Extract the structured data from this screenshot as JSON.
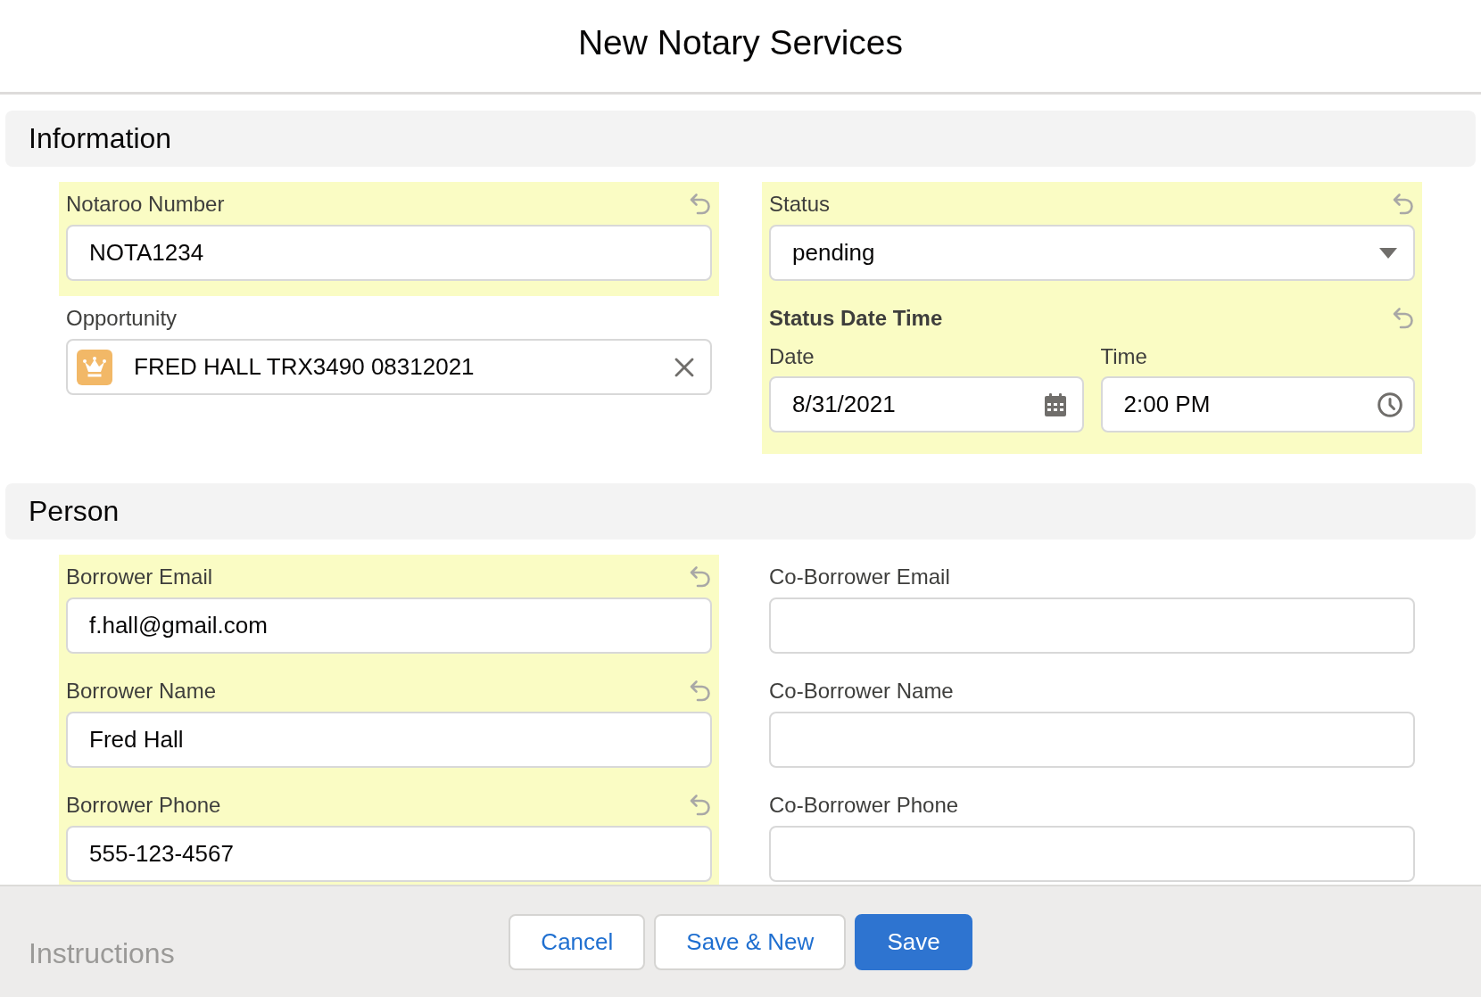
{
  "dialog": {
    "title": "New Notary Services"
  },
  "sections": [
    {
      "title": "Information",
      "columns": [
        [
          {
            "kind": "text",
            "label": "Notaroo Number",
            "value": "NOTA1234",
            "changed": true
          },
          {
            "kind": "lookup",
            "label": "Opportunity",
            "value": "FRED HALL TRX3490 08312021",
            "changed": false
          }
        ],
        [
          {
            "kind": "picklist",
            "label": "Status",
            "value": "pending",
            "changed": true
          },
          {
            "kind": "datetime",
            "label": "Status Date Time",
            "changed": true,
            "date": {
              "label": "Date",
              "value": "8/31/2021"
            },
            "time": {
              "label": "Time",
              "value": "2:00 PM"
            }
          }
        ]
      ]
    },
    {
      "title": "Person",
      "columns": [
        [
          {
            "kind": "text",
            "label": "Borrower Email",
            "value": "f.hall@gmail.com",
            "changed": true
          },
          {
            "kind": "text",
            "label": "Borrower Name",
            "value": "Fred Hall",
            "changed": true
          },
          {
            "kind": "text",
            "label": "Borrower Phone",
            "value": "555-123-4567",
            "changed": true
          }
        ],
        [
          {
            "kind": "text",
            "label": "Co-Borrower Email",
            "changed": false
          },
          {
            "kind": "text",
            "label": "Co-Borrower Name",
            "changed": false
          },
          {
            "kind": "text",
            "label": "Co-Borrower Phone",
            "changed": false
          }
        ]
      ]
    }
  ],
  "footer": {
    "faded_section_title": "Instructions",
    "buttons": [
      {
        "label": "Cancel",
        "kind": "neutral"
      },
      {
        "label": "Save & New",
        "kind": "neutral"
      },
      {
        "label": "Save",
        "kind": "brand"
      }
    ]
  }
}
